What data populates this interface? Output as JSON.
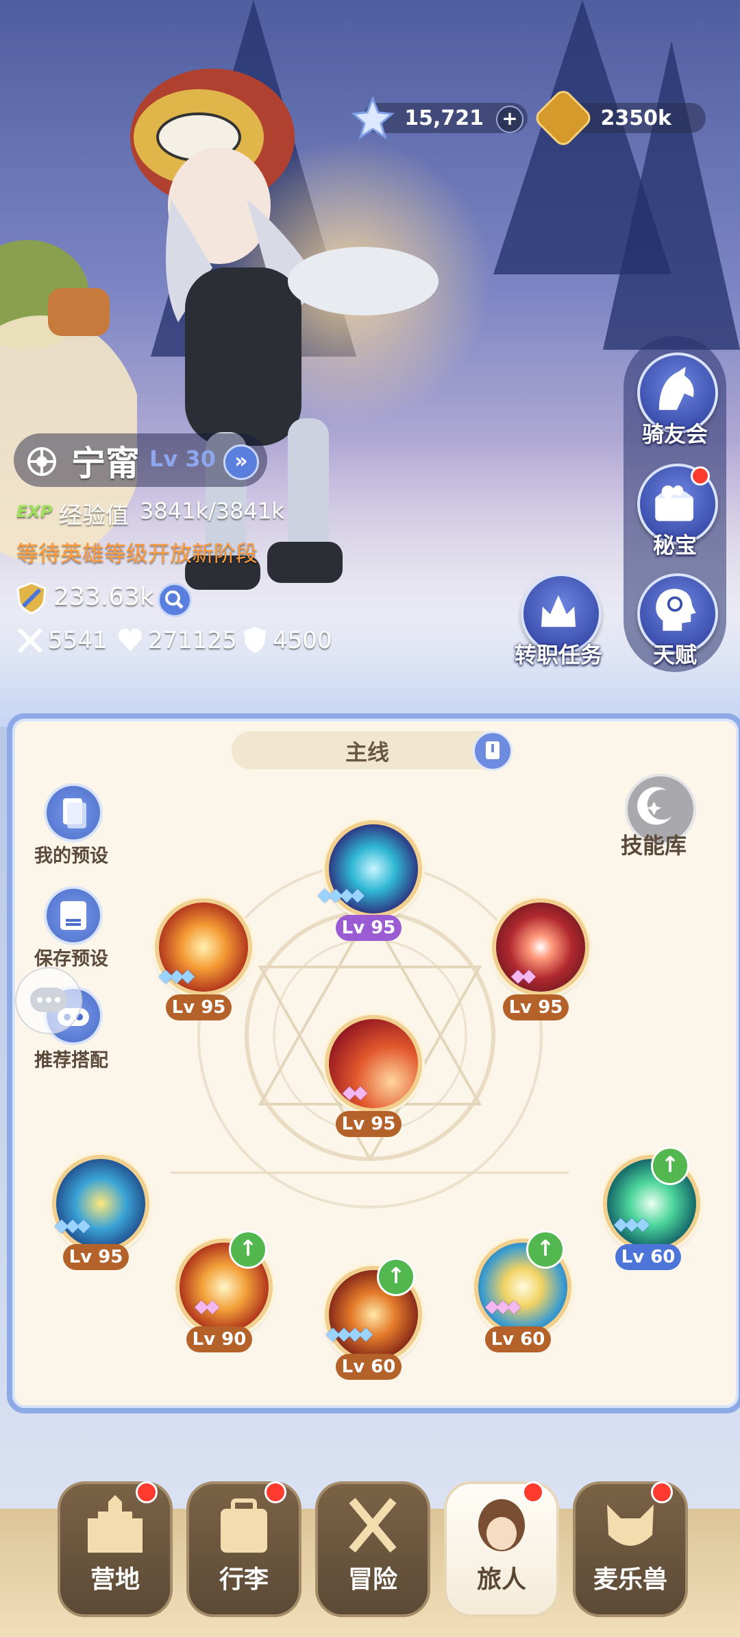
{
  "resources": {
    "stars": "15,721",
    "plus": "+",
    "coins": "2350k"
  },
  "hero": {
    "name": "宁甯",
    "level": "Lv 30",
    "exp_tag": "EXP",
    "exp_label": "经验值",
    "exp_value": "3841k/3841k",
    "notice": "等待英雄等级开放新阶段",
    "power": "233.63k",
    "attack": "5541",
    "hp": "271125",
    "defense": "4500"
  },
  "side_menu": [
    {
      "label": "骑友会",
      "icon": "horse-icon",
      "badge": false
    },
    {
      "label": "秘宝",
      "icon": "treasure-chest-icon",
      "badge": true
    },
    {
      "label": "天赋",
      "icon": "brain-head-icon",
      "badge": false
    }
  ],
  "job_quest": {
    "label": "转职任务",
    "icon": "crown-helmet-icon"
  },
  "skill_panel": {
    "tab": "主线",
    "left_buttons": [
      "我的预设",
      "保存预设",
      "推荐搭配"
    ],
    "library": "技能库",
    "skills": [
      {
        "level": "Lv 95",
        "stars": 4,
        "star_color": "blue",
        "label_color": "purple",
        "upgrade": false
      },
      {
        "level": "Lv 95",
        "stars": 3,
        "star_color": "blue",
        "label_color": "orange",
        "upgrade": false
      },
      {
        "level": "Lv 95",
        "stars": 2,
        "star_color": "pink",
        "label_color": "orange",
        "upgrade": false
      },
      {
        "level": "Lv 95",
        "stars": 2,
        "star_color": "pink",
        "label_color": "orange",
        "upgrade": false
      },
      {
        "level": "Lv 95",
        "stars": 3,
        "star_color": "blue",
        "label_color": "orange",
        "upgrade": false
      },
      {
        "level": "Lv 60",
        "stars": 3,
        "star_color": "blue",
        "label_color": "blue",
        "upgrade": true
      },
      {
        "level": "Lv 90",
        "stars": 2,
        "star_color": "pink",
        "label_color": "orange",
        "upgrade": true
      },
      {
        "level": "Lv 60",
        "stars": 4,
        "star_color": "blue",
        "label_color": "orange",
        "upgrade": true
      },
      {
        "level": "Lv 60",
        "stars": 3,
        "star_color": "pink",
        "label_color": "orange",
        "upgrade": true
      }
    ]
  },
  "bottom_nav": [
    {
      "label": "营地",
      "badge": true,
      "active": false
    },
    {
      "label": "行李",
      "badge": true,
      "active": false
    },
    {
      "label": "冒险",
      "badge": false,
      "active": false
    },
    {
      "label": "旅人",
      "badge": true,
      "active": true
    },
    {
      "label": "麦乐兽",
      "badge": true,
      "active": false
    }
  ],
  "colors": {
    "panel_border": "#8da9e6",
    "level_orange": "#b5612a",
    "level_purple": "#9b5bd3",
    "level_blue": "#4d74d8",
    "notice_orange": "#ff9a3c",
    "badge_red": "#ff3b30"
  }
}
